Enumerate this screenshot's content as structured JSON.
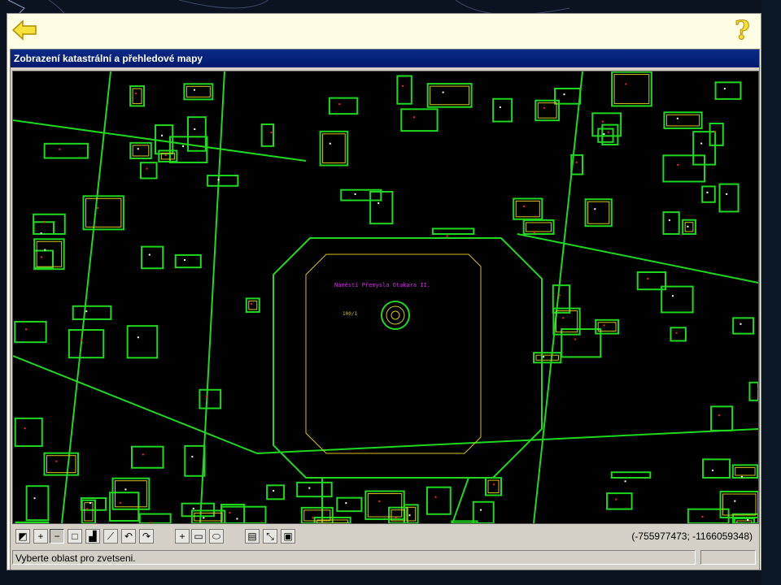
{
  "window": {
    "back_icon": "back-arrow-icon",
    "help_icon": "help-question-icon"
  },
  "panel": {
    "title": "Zobrazení katastrální a přehledové mapy"
  },
  "map": {
    "square_label": "Náměstí Přemysla Otakara II.",
    "parcel_label": "100/1",
    "colors": {
      "background": "#000000",
      "parcel_lines": "#1fd81f",
      "building_lines": "#d8c020",
      "labels": "#ff2020",
      "street_labels": "#d030e0"
    }
  },
  "toolbar": {
    "tools": [
      {
        "name": "map-select-icon",
        "glyph": "◩"
      },
      {
        "name": "zoom-in-icon",
        "glyph": "+"
      },
      {
        "name": "zoom-out-icon",
        "glyph": "−"
      },
      {
        "name": "full-extent-icon",
        "glyph": "□"
      },
      {
        "name": "layers-icon",
        "glyph": "▟"
      },
      {
        "name": "measure-icon",
        "glyph": "⟋"
      },
      {
        "name": "undo-icon",
        "glyph": "↶"
      },
      {
        "name": "redo-icon",
        "glyph": "↷"
      },
      {
        "name": "pan-crosshair-icon",
        "glyph": "+"
      },
      {
        "name": "select-rectangle-icon",
        "glyph": "▭"
      },
      {
        "name": "select-polygon-icon",
        "glyph": "⬭"
      },
      {
        "name": "print-icon",
        "glyph": "▤"
      },
      {
        "name": "info-icon",
        "glyph": "⤡"
      },
      {
        "name": "export-icon",
        "glyph": "▣"
      }
    ],
    "coordinates": "(-755977473; -1166059348)"
  },
  "status": {
    "message": "Vyberte oblast pro zvetseni."
  }
}
